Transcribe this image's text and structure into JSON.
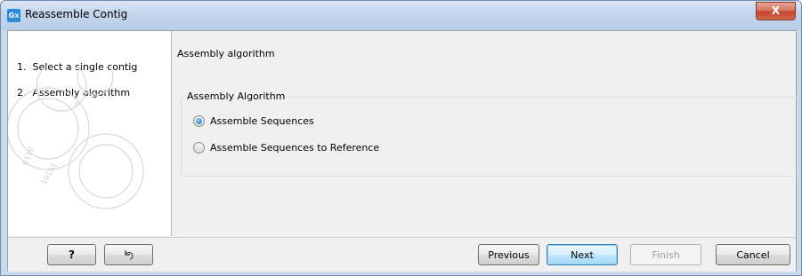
{
  "window": {
    "title": "Reassemble Contig",
    "app_icon_text": "Gx",
    "close_label": "X"
  },
  "steps": [
    {
      "number": "1.",
      "label": "Select a single contig"
    },
    {
      "number": "2.",
      "label": "Assembly algorithm"
    }
  ],
  "main": {
    "title": "Assembly algorithm",
    "group_label": "Assembly Algorithm",
    "options": [
      {
        "label": "Assemble Sequences",
        "checked": true
      },
      {
        "label": "Assemble Sequences to Reference",
        "checked": false
      }
    ]
  },
  "footer": {
    "help_label": "?",
    "previous_label": "Previous",
    "next_label": "Next",
    "finish_label": "Finish",
    "cancel_label": "Cancel"
  }
}
